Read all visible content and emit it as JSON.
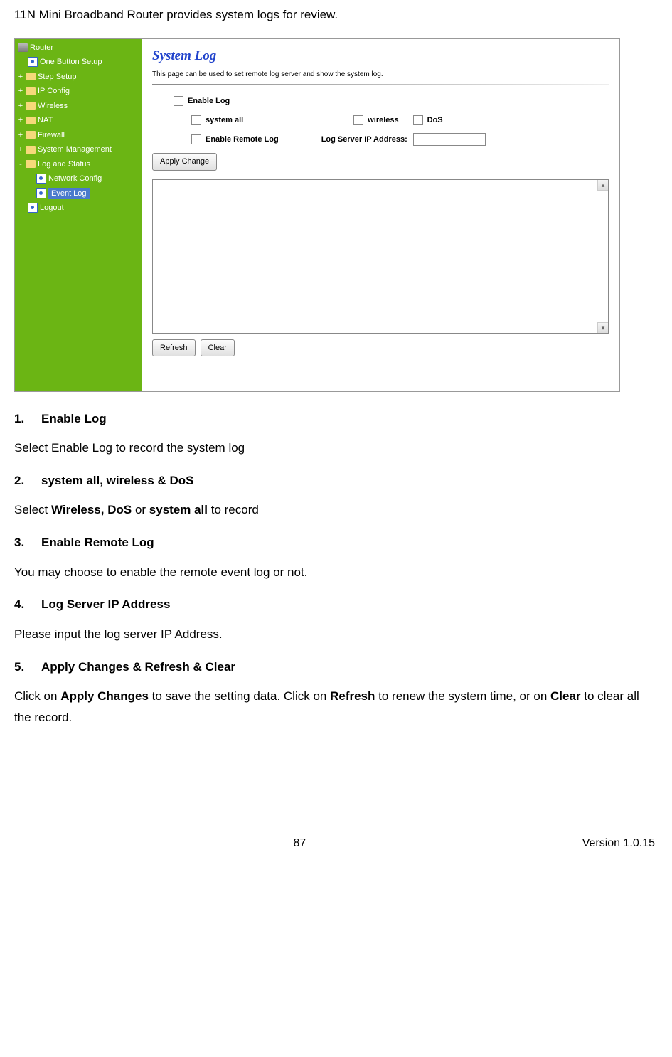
{
  "header": {
    "text": "11N Mini Broadband Router    provides system logs for review."
  },
  "nav": {
    "root": "Router",
    "items": [
      {
        "expander": "",
        "icon": "page",
        "label": "One Button Setup",
        "indent": 1
      },
      {
        "expander": "+",
        "icon": "folder",
        "label": "Step Setup",
        "indent": 0
      },
      {
        "expander": "+",
        "icon": "folder",
        "label": "IP Config",
        "indent": 0
      },
      {
        "expander": "+",
        "icon": "folder",
        "label": "Wireless",
        "indent": 0
      },
      {
        "expander": "+",
        "icon": "folder",
        "label": "NAT",
        "indent": 0
      },
      {
        "expander": "+",
        "icon": "folder",
        "label": "Firewall",
        "indent": 0
      },
      {
        "expander": "+",
        "icon": "folder",
        "label": "System Management",
        "indent": 0
      },
      {
        "expander": "-",
        "icon": "folder",
        "label": "Log and Status",
        "indent": 0
      },
      {
        "expander": "",
        "icon": "page",
        "label": "Network Config",
        "indent": 2
      },
      {
        "expander": "",
        "icon": "page",
        "label": "Event Log",
        "indent": 2,
        "selected": true
      },
      {
        "expander": "",
        "icon": "page",
        "label": "Logout",
        "indent": 1
      }
    ]
  },
  "panel": {
    "title": "System Log",
    "desc": "This page can be used to set remote log server and show the system log.",
    "enable_log": "Enable Log",
    "system_all": "system all",
    "wireless": "wireless",
    "dos": "DoS",
    "enable_remote": "Enable Remote Log",
    "log_server_label": "Log Server IP Address:",
    "apply_btn": "Apply Change",
    "refresh_btn": "Refresh",
    "clear_btn": "Clear"
  },
  "sections": {
    "s1_num": "1.",
    "s1_title": "Enable Log",
    "s1_body": "Select Enable Log to record the system log",
    "s2_num": "2.",
    "s2_title": "system all, wireless & DoS",
    "s2_body_pre": "Select ",
    "s2_body_b1": "Wireless, DoS",
    "s2_body_mid": " or ",
    "s2_body_b2": "system all",
    "s2_body_post": " to record",
    "s3_num": "3.",
    "s3_title": "Enable Remote Log",
    "s3_body": "You may choose to enable the remote event log or not.",
    "s4_num": "4.",
    "s4_title": "Log Server IP Address",
    "s4_body": "Please input the log server IP Address.",
    "s5_num": "5.",
    "s5_title": "Apply Changes & Refresh & Clear",
    "s5_body_pre": "Click on ",
    "s5_body_b1": "Apply Changes",
    "s5_body_mid1": " to save the setting data. Click on ",
    "s5_body_b2": "Refresh",
    "s5_body_mid2": " to renew the system time, or on ",
    "s5_body_b3": "Clear",
    "s5_body_post": " to clear all the record."
  },
  "footer": {
    "page": "87",
    "version": "Version 1.0.15"
  }
}
